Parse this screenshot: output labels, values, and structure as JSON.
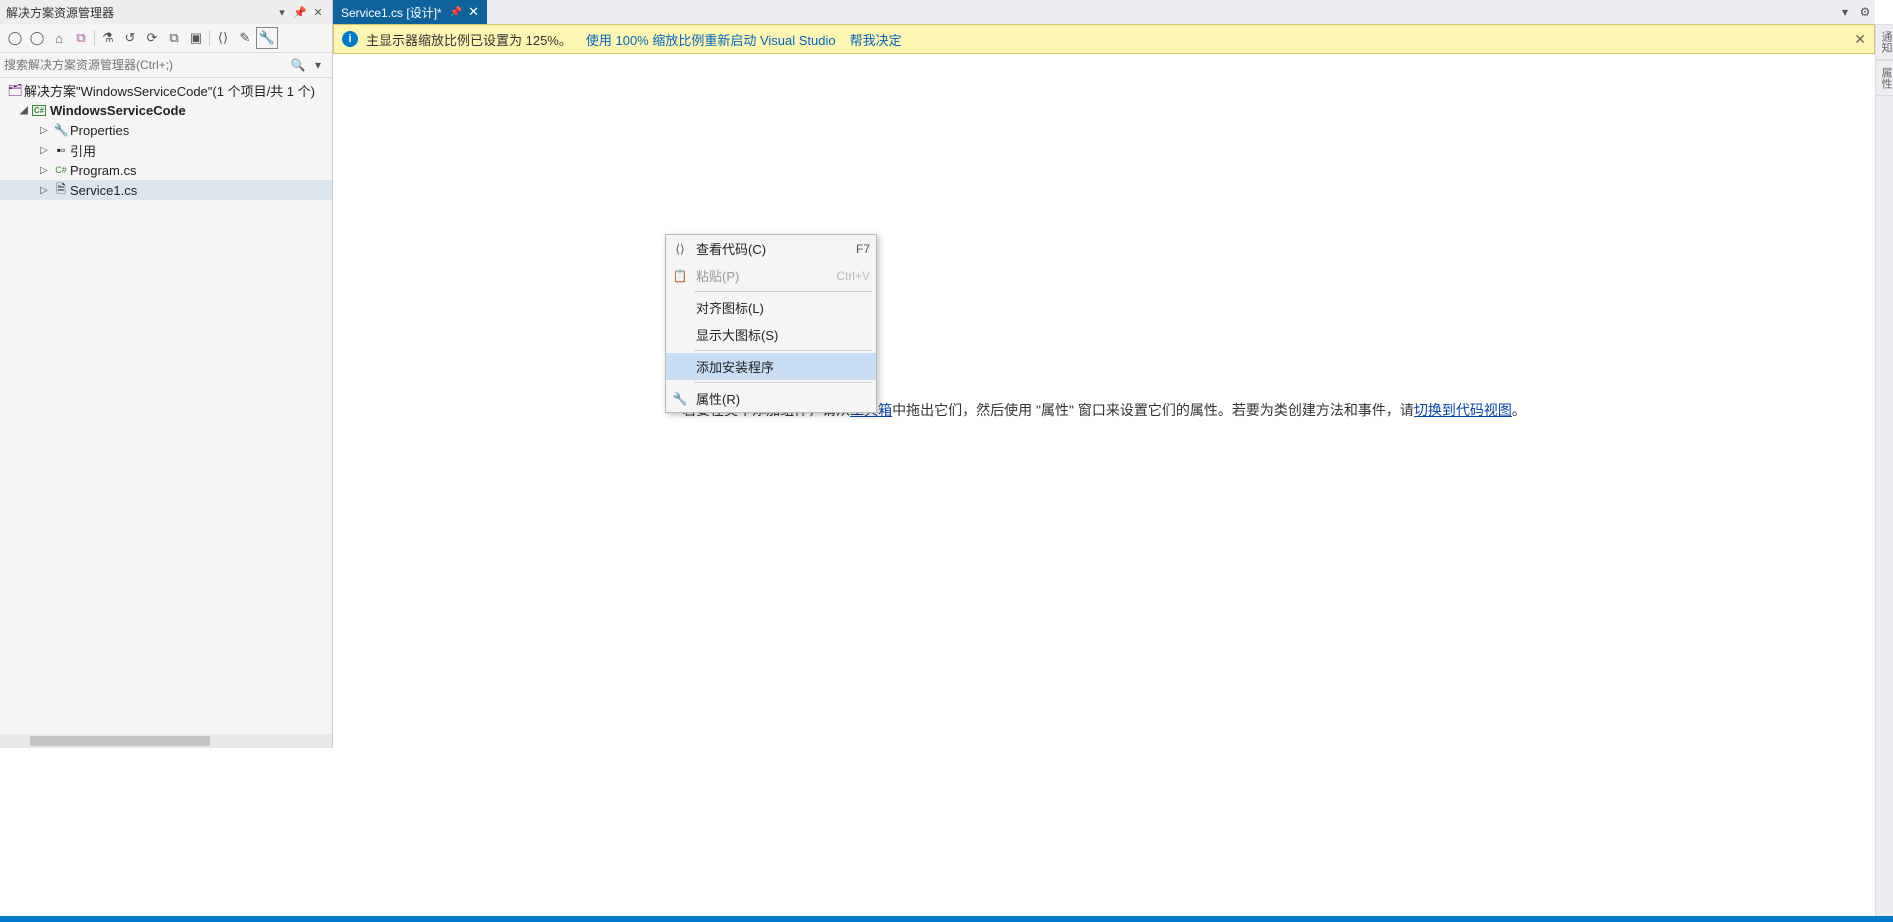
{
  "panel": {
    "title": "解决方案资源管理器",
    "search_placeholder": "搜索解决方案资源管理器(Ctrl+;)"
  },
  "tree": {
    "solution": "解决方案\"WindowsServiceCode\"(1 个项目/共 1 个)",
    "project": "WindowsServiceCode",
    "items": [
      {
        "label": "Properties"
      },
      {
        "label": "引用"
      },
      {
        "label": "Program.cs"
      },
      {
        "label": "Service1.cs"
      }
    ]
  },
  "tab": {
    "title": "Service1.cs [设计]*"
  },
  "info": {
    "text": "主显示器缩放比例已设置为 125%。",
    "link1": "使用 100% 缩放比例重新启动 Visual Studio",
    "link2": "帮我决定"
  },
  "hint": {
    "p1": "若要在类中添加组件，请从",
    "link1": "工具箱",
    "p2": "中拖出它们，然后使用 \"属性\" 窗口来设置它们的属性。若要为类创建方法和事件，请",
    "link2": "切换到代码视图",
    "p3": "。"
  },
  "ctx": {
    "items": [
      {
        "label": "查看代码(C)",
        "shortcut": "F7",
        "icon": "code"
      },
      {
        "label": "粘贴(P)",
        "shortcut": "Ctrl+V",
        "icon": "paste",
        "disabled": true
      },
      {
        "sep": true
      },
      {
        "label": "对齐图标(L)"
      },
      {
        "label": "显示大图标(S)"
      },
      {
        "sep": true
      },
      {
        "label": "添加安装程序",
        "hl": true
      },
      {
        "sep": true
      },
      {
        "label": "属性(R)",
        "icon": "wrench"
      }
    ]
  },
  "right_tabs": {
    "t1": "通知",
    "t2": "属性"
  }
}
